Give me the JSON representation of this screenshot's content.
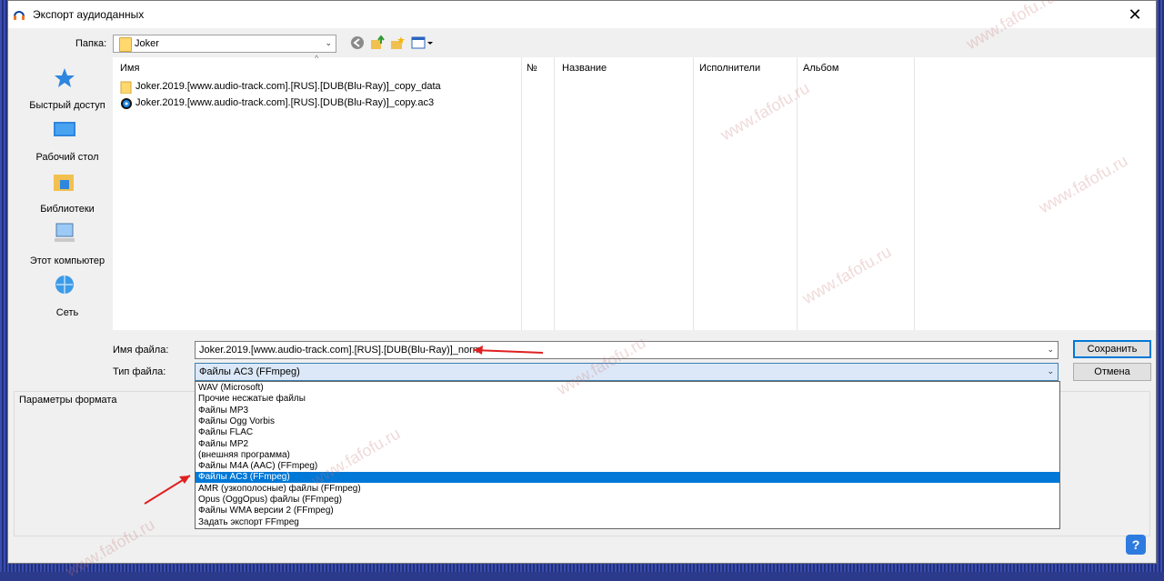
{
  "window": {
    "title": "Экспорт аудиоданных",
    "close_glyph": "✕"
  },
  "folder": {
    "label": "Папка:",
    "current": "Joker"
  },
  "places": [
    {
      "label": "Быстрый доступ",
      "icon": "star-icon"
    },
    {
      "label": "Рабочий стол",
      "icon": "desktop-icon"
    },
    {
      "label": "Библиотеки",
      "icon": "libraries-icon"
    },
    {
      "label": "Этот компьютер",
      "icon": "computer-icon"
    },
    {
      "label": "Сеть",
      "icon": "network-icon"
    }
  ],
  "columns": {
    "name": "Имя",
    "num": "№",
    "title": "Название",
    "artist": "Исполнители",
    "album": "Альбом",
    "sort_glyph": "^"
  },
  "files": [
    {
      "name": "Joker.2019.[www.audio-track.com].[RUS].[DUB(Blu-Ray)]_copy_data",
      "icon": "folder-icon"
    },
    {
      "name": "Joker.2019.[www.audio-track.com].[RUS].[DUB(Blu-Ray)]_copy.ac3",
      "icon": "audio-file-icon"
    }
  ],
  "filename": {
    "label": "Имя файла:",
    "value": "Joker.2019.[www.audio-track.com].[RUS].[DUB(Blu-Ray)]_norm"
  },
  "filetype": {
    "label": "Тип файла:",
    "value": "Файлы AC3 (FFmpeg)"
  },
  "buttons": {
    "save": "Сохранить",
    "cancel": "Отмена",
    "help": "?"
  },
  "format_group": {
    "title": "Параметры формата"
  },
  "dropdown_options": [
    "WAV (Microsoft)",
    "Прочие несжатые файлы",
    "Файлы MP3",
    "Файлы Ogg Vorbis",
    "Файлы FLAC",
    "Файлы MP2",
    "(внешняя программа)",
    "Файлы M4A (AAC) (FFmpeg)",
    "Файлы AC3 (FFmpeg)",
    "AMR (узкополосные) файлы (FFmpeg)",
    "Opus (OggOpus) файлы (FFmpeg)",
    "Файлы WMA версии 2 (FFmpeg)",
    "Задать экспорт FFmpeg"
  ],
  "dropdown_selected_index": 8,
  "watermark": "www.fafofu.ru",
  "colors": {
    "selection": "#0078d7",
    "arrow": "#e02020",
    "accent_blue": "#2e7be0"
  }
}
